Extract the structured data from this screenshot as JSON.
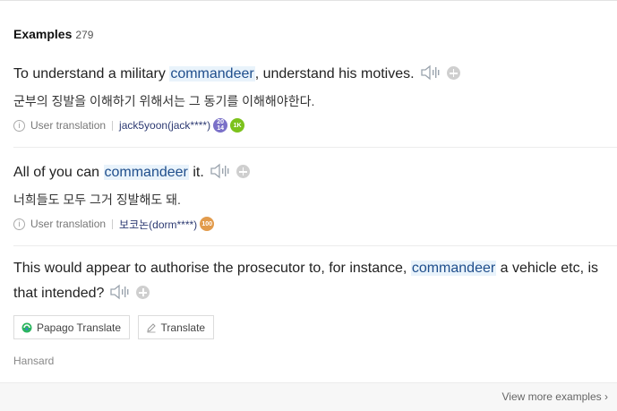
{
  "header": {
    "title": "Examples",
    "count": "279"
  },
  "examples": [
    {
      "pre": "To understand a military ",
      "keyword": "commandeer",
      "post": ", understand his motives.",
      "translation": "군부의 징발을 이해하기 위해서는 그 동기를 이해해야한다.",
      "source_type": "User translation",
      "user": "jack5yoon(jack****)",
      "badges": [
        {
          "label": "20 14",
          "color": "#7a70c8"
        },
        {
          "label": "1K",
          "color": "#7cc21c"
        }
      ]
    },
    {
      "pre": "All of you can ",
      "keyword": "commandeer",
      "post": " it.",
      "translation": "너희들도 모두 그거 징발해도 돼.",
      "source_type": "User translation",
      "user": "보코논(dorm****)",
      "badges": [
        {
          "label": "100",
          "color": "#e29b4c"
        }
      ]
    },
    {
      "pre": "This would appear to authorise the prosecutor to, for instance, ",
      "keyword": "commandeer",
      "post": " a vehicle etc, is that intended?",
      "buttons": {
        "papago": "Papago Translate",
        "translate": "Translate"
      },
      "source": "Hansard"
    }
  ],
  "footer": {
    "more": "View more examples"
  },
  "icons": [
    "speaker-icon",
    "add-icon",
    "info-icon",
    "papago-icon",
    "pencil-icon",
    "chevron-right-icon"
  ]
}
